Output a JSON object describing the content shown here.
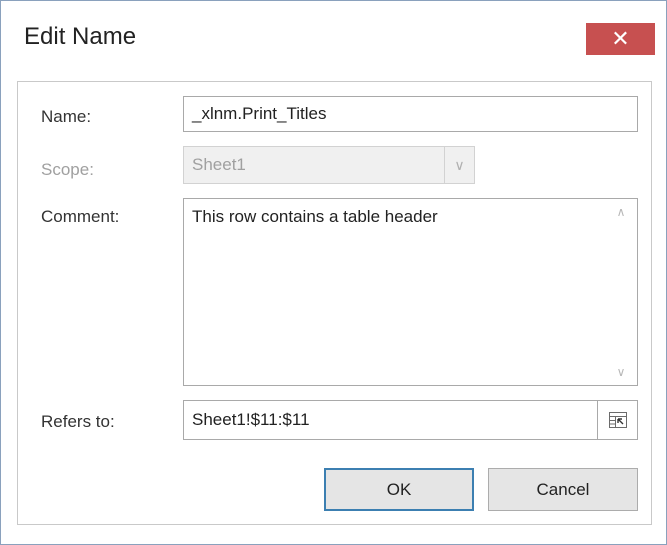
{
  "dialog": {
    "title": "Edit Name",
    "close_glyph": "✕"
  },
  "form": {
    "name_label": "Name:",
    "name_value": "_xlnm.Print_Titles",
    "scope_label": "Scope:",
    "scope_value": "Sheet1",
    "scope_enabled": false,
    "comment_label": "Comment:",
    "comment_value": "This row contains a table header",
    "refers_label": "Refers to:",
    "refers_value": "Sheet1!$11:$11"
  },
  "icons": {
    "combo_arrow": "chevron-down-icon",
    "scroll_up": "chevron-up-icon",
    "scroll_down": "chevron-down-icon",
    "collapse": "collapse-dialog-icon"
  },
  "buttons": {
    "ok_label": "OK",
    "cancel_label": "Cancel"
  },
  "colors": {
    "close_button": "#c75050",
    "default_button_border": "#3c7fb1",
    "disabled_text": "#a0a0a0"
  }
}
